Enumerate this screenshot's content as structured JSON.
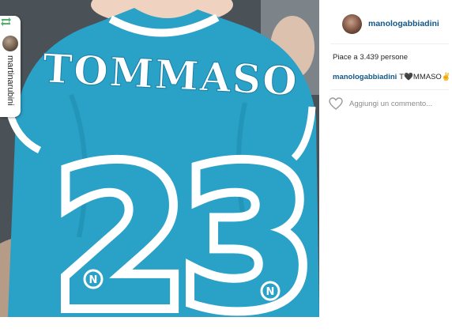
{
  "repost": {
    "username": "martinarubini",
    "repost_icon": "repost-icon"
  },
  "photo": {
    "jersey_name": "TOMMASO",
    "jersey_number": "23",
    "badge_letter": "N",
    "colors": {
      "jersey": "#2aa1c6",
      "print": "#ffffff",
      "background": "#3d4448"
    }
  },
  "post": {
    "author": "manologabbiadini",
    "likes_text": "Piace a 3.439 persone",
    "caption_user": "manologabbiadini",
    "caption_text": "T🖤MMASO✌"
  },
  "comment": {
    "placeholder": "Aggiungi un commento...",
    "like_icon": "heart-outline-icon"
  },
  "colors": {
    "username": "#125688",
    "text": "#262626",
    "muted": "#8a8a8a"
  }
}
